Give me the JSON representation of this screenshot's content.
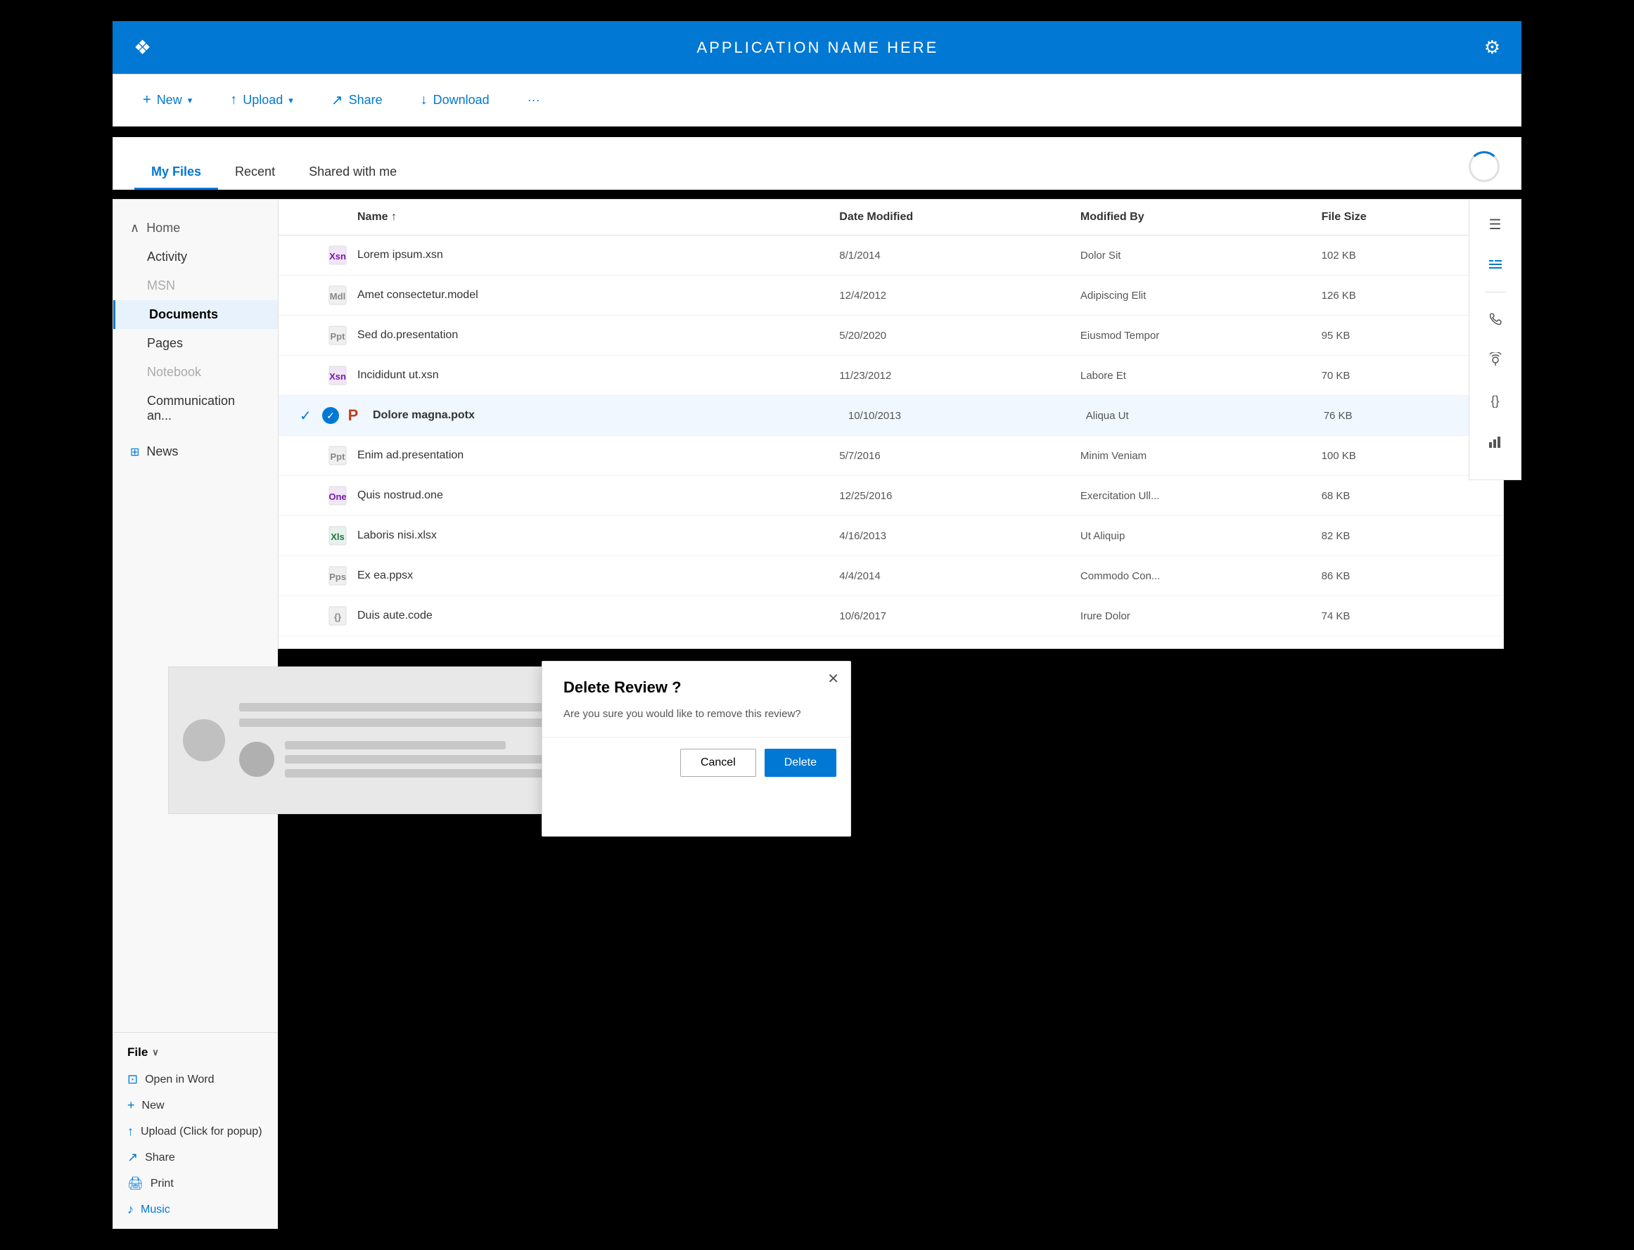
{
  "header": {
    "title": "APPLICATION NAME HERE",
    "logo_icon": "❖",
    "gear_icon": "⚙"
  },
  "toolbar": {
    "new_label": "New",
    "upload_label": "Upload",
    "share_label": "Share",
    "download_label": "Download",
    "more_label": "···"
  },
  "tabs": {
    "items": [
      {
        "label": "My Files",
        "active": true
      },
      {
        "label": "Recent",
        "active": false
      },
      {
        "label": "Shared with me",
        "active": false
      }
    ]
  },
  "sidebar": {
    "home_label": "Home",
    "items": [
      {
        "label": "Activity",
        "active": false,
        "indented": true
      },
      {
        "label": "MSN",
        "active": false,
        "indented": true,
        "muted": true
      },
      {
        "label": "Documents",
        "active": true,
        "indented": true
      },
      {
        "label": "Pages",
        "active": false,
        "indented": true
      },
      {
        "label": "Notebook",
        "active": false,
        "indented": true,
        "muted": true
      },
      {
        "label": "Communication an...",
        "active": false,
        "indented": true
      }
    ],
    "news_label": "News",
    "file_menu": {
      "header": "File",
      "items": [
        {
          "label": "Open in Word",
          "icon": "⊡"
        },
        {
          "label": "New",
          "icon": "+"
        },
        {
          "label": "Upload (Click for popup)",
          "icon": "↑"
        },
        {
          "label": "Share",
          "icon": "↗"
        },
        {
          "label": "Print",
          "icon": "🖨"
        },
        {
          "label": "Music",
          "icon": "♪"
        }
      ]
    }
  },
  "file_list": {
    "columns": {
      "name": "Name ↑",
      "date_modified": "Date Modified",
      "modified_by": "Modified By",
      "file_size": "File Size"
    },
    "files": [
      {
        "name": "Lorem ipsum.xsn",
        "date": "8/1/2014",
        "modified_by": "Dolor Sit",
        "size": "102 KB",
        "type": "xsn",
        "selected": false
      },
      {
        "name": "Amet consectetur.model",
        "date": "12/4/2012",
        "modified_by": "Adipiscing Elit",
        "size": "126 KB",
        "type": "model",
        "selected": false
      },
      {
        "name": "Sed do.presentation",
        "date": "5/20/2020",
        "modified_by": "Eiusmod Tempor",
        "size": "95 KB",
        "type": "pptx-gray",
        "selected": false
      },
      {
        "name": "Incididunt ut.xsn",
        "date": "11/23/2012",
        "modified_by": "Labore Et",
        "size": "70 KB",
        "type": "xsn",
        "selected": false
      },
      {
        "name": "Dolore magna.potx",
        "date": "10/10/2013",
        "modified_by": "Aliqua Ut",
        "size": "76 KB",
        "type": "pptx-red",
        "selected": true
      },
      {
        "name": "Enim ad.presentation",
        "date": "5/7/2016",
        "modified_by": "Minim Veniam",
        "size": "100 KB",
        "type": "pptx-gray",
        "selected": false
      },
      {
        "name": "Quis nostrud.one",
        "date": "12/25/2016",
        "modified_by": "Exercitation Ull...",
        "size": "68 KB",
        "type": "one",
        "selected": false
      },
      {
        "name": "Laboris nisi.xlsx",
        "date": "4/16/2013",
        "modified_by": "Ut Aliquip",
        "size": "82 KB",
        "type": "xlsx",
        "selected": false
      },
      {
        "name": "Ex ea.ppsx",
        "date": "4/4/2014",
        "modified_by": "Commodo Con...",
        "size": "86 KB",
        "type": "ppsx",
        "selected": false
      },
      {
        "name": "Duis aute.code",
        "date": "10/6/2017",
        "modified_by": "Irure Dolor",
        "size": "74 KB",
        "type": "code",
        "selected": false
      }
    ]
  },
  "right_panel": {
    "icons": [
      "☰",
      "≡",
      "☎",
      "📡",
      "{}",
      "📊"
    ]
  },
  "modal": {
    "title": "Delete Review ?",
    "body": "Are you sure you would like to remove this review?",
    "cancel_label": "Cancel",
    "delete_label": "Delete"
  }
}
